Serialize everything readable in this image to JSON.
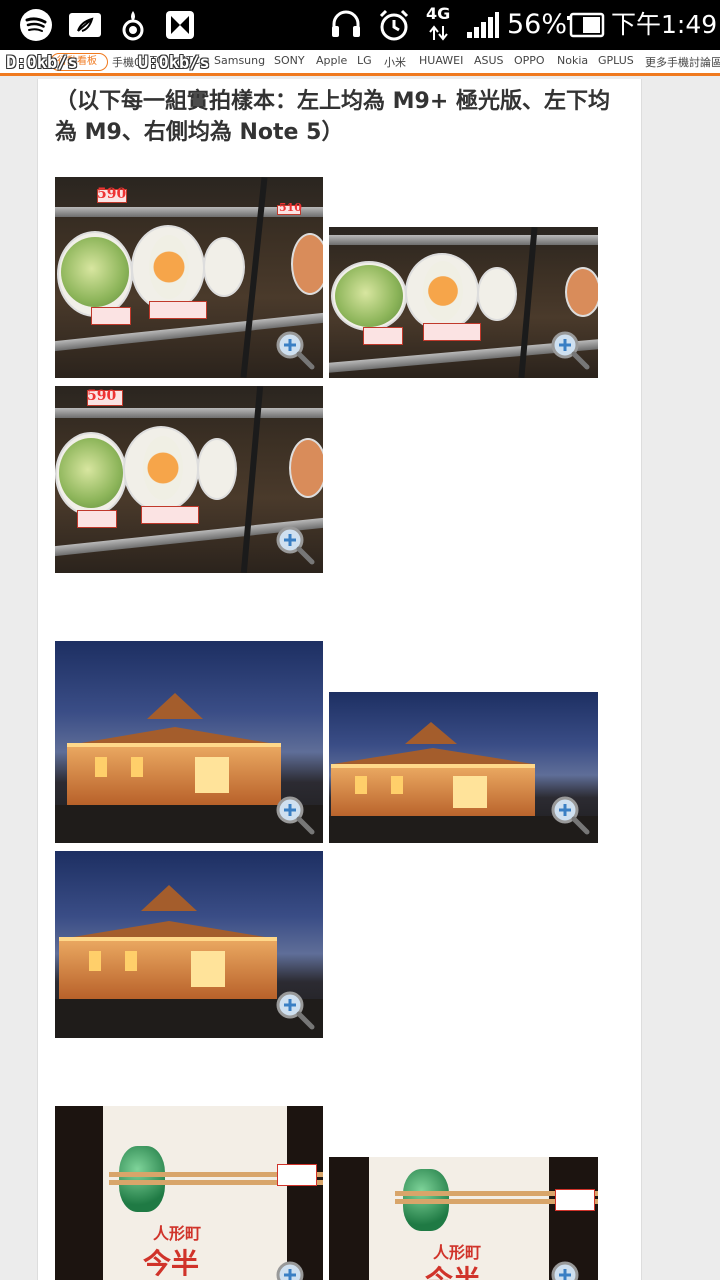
{
  "status_bar": {
    "network_label": "4G",
    "battery_percent": "56%",
    "time": "下午1:49"
  },
  "net_speed": {
    "download": "D:0kb/s",
    "upload": "U:0kb/s"
  },
  "nav": {
    "tag_label": "行動看板",
    "items": [
      "手機01",
      "TC",
      "HTC",
      "Samsung",
      "SONY",
      "Apple",
      "LG",
      "小米",
      "HUAWEI",
      "ASUS",
      "OPPO",
      "Nokia",
      "GPLUS",
      "更多手機討論區"
    ]
  },
  "article": {
    "caption": "（以下每一組實拍樣本：左上均為 M9+ 極光版、左下均為 M9、右側均為 Note 5）"
  },
  "photos": {
    "food_tags": [
      "590",
      "510",
      "590"
    ],
    "stamp_line1": "人形町",
    "stamp_line2": "今半"
  },
  "colors": {
    "accent": "#f07a1f",
    "status_bg": "#000000",
    "page_bg": "#ececec",
    "card_bg": "#ffffff"
  },
  "icons": [
    "spotify-icon",
    "notification-icon",
    "app-icon",
    "app-icon-2",
    "headset-icon",
    "alarm-icon",
    "signal-icon",
    "battery-icon",
    "zoom-icon"
  ]
}
